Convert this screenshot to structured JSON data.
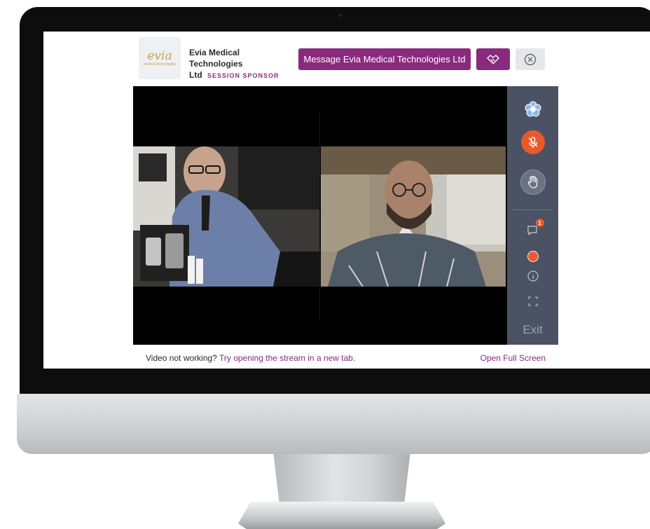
{
  "sponsor": {
    "logo_text": "evia",
    "logo_subtext": "medical technologies",
    "name_line1": "Evia Medical Technologies",
    "name_line2": "Ltd",
    "tag": "SESSION SPONSOR",
    "message_button_label": "Message Evia Medical Technologies Ltd"
  },
  "controls": {
    "notification_count": "1",
    "exit_label": "Exit"
  },
  "footer": {
    "prompt_text": "Video not working?",
    "link_text": "Try opening the stream in a new tab.",
    "fullscreen_label": "Open Full Screen"
  },
  "colors": {
    "brand_purple": "#8a2a7e",
    "control_panel": "#4a5263",
    "mic_active": "#e85a2b",
    "logo_gold": "#c8a04a"
  },
  "icons": [
    "handshake-icon",
    "close-icon",
    "reaction-icon",
    "mic-off-icon",
    "raise-hand-icon",
    "chat-icon",
    "record-dot-icon",
    "info-icon",
    "expand-icon"
  ]
}
